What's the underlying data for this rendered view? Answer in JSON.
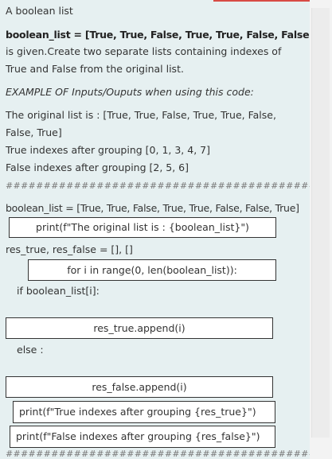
{
  "title": "A boolean list",
  "statement": {
    "line1": "boolean_list = [True, True, False, True, True, False, False, True]",
    "line2": "is given.Create two separate lists containing indexes of",
    "line3": "True and False from the original list."
  },
  "example_heading": "EXAMPLE OF Inputs/Ouputs when using this code:",
  "example_output": {
    "line1": "The original list is : [True, True, False, True, True, False,",
    "line2": "False, True]",
    "line3": "True indexes after grouping [0, 1, 3, 4, 7]",
    "line4": "False indexes after grouping [2, 5, 6]"
  },
  "separator": "############################################",
  "code": {
    "line1": "boolean_list = [True, True, False, True, True, False, False, True]",
    "print_original": "print(f\"The original list is : {boolean_list}\")",
    "init": "res_true, res_false = [], []",
    "for_loop": "for i in range(0, len(boolean_list)):",
    "if_stmt": "if boolean_list[i]:",
    "append_true": "res_true.append(i)",
    "else_stmt": "else :",
    "append_false": "res_false.append(i)",
    "print_true": "print(f\"True indexes after grouping {res_true}\")",
    "print_false": "print(f\"False indexes after grouping {res_false}\")"
  },
  "separator_bottom": "################################################"
}
